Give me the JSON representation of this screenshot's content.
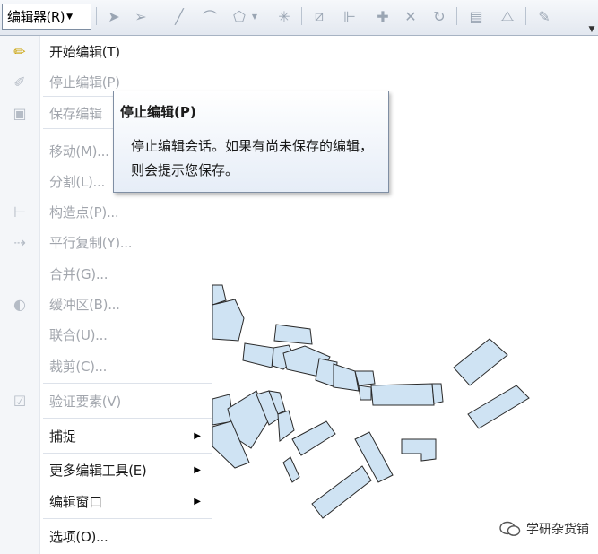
{
  "toolbar": {
    "editor_menu_label": "编辑器(R)",
    "icons": [
      "edit-tool-icon",
      "edit-annotation-tool-icon",
      "straight-segment-icon",
      "endpoint-arc-icon",
      "trace-icon",
      "point-icon",
      "edit-vertices-icon",
      "reshape-icon",
      "cut-polygons-icon",
      "split-icon",
      "rotate-icon",
      "attributes-icon",
      "sketch-properties-icon",
      "create-features-icon"
    ]
  },
  "menu": {
    "items": [
      {
        "label": "开始编辑(T)",
        "icon": "start-editing-icon",
        "enabled": true
      },
      {
        "label": "停止编辑(P)",
        "icon": "stop-editing-icon",
        "enabled": false
      },
      {
        "label": "保存编辑",
        "icon": "save-edits-icon",
        "enabled": false
      },
      {
        "label": "移动(M)...",
        "icon": "",
        "enabled": false
      },
      {
        "label": "分割(L)...",
        "icon": "",
        "enabled": false
      },
      {
        "label": "构造点(P)...",
        "icon": "construct-points-icon",
        "enabled": false
      },
      {
        "label": "平行复制(Y)...",
        "icon": "copy-parallel-icon",
        "enabled": false
      },
      {
        "label": "合并(G)...",
        "icon": "",
        "enabled": false
      },
      {
        "label": "缓冲区(B)...",
        "icon": "buffer-icon",
        "enabled": false
      },
      {
        "label": "联合(U)...",
        "icon": "",
        "enabled": false
      },
      {
        "label": "裁剪(C)...",
        "icon": "",
        "enabled": false
      },
      {
        "label": "验证要素(V)",
        "icon": "validate-features-icon",
        "enabled": false
      },
      {
        "label": "捕捉",
        "icon": "",
        "enabled": true,
        "submenu": true
      },
      {
        "label": "更多编辑工具(E)",
        "icon": "",
        "enabled": true,
        "submenu": true
      },
      {
        "label": "编辑窗口",
        "icon": "",
        "enabled": true,
        "submenu": true
      },
      {
        "label": "选项(O)...",
        "icon": "",
        "enabled": true
      }
    ]
  },
  "tooltip": {
    "title": "停止编辑(P)",
    "body": "停止编辑会话。如果有尚未保存的编辑，则会提示您保存。"
  },
  "watermark": {
    "text": "学研杂货铺"
  },
  "colors": {
    "polygon_fill": "#cfe3f3",
    "polygon_stroke": "#2a2a2a",
    "toolbar_bg": "#e8edf4",
    "tooltip_border": "#7f8ea3"
  }
}
